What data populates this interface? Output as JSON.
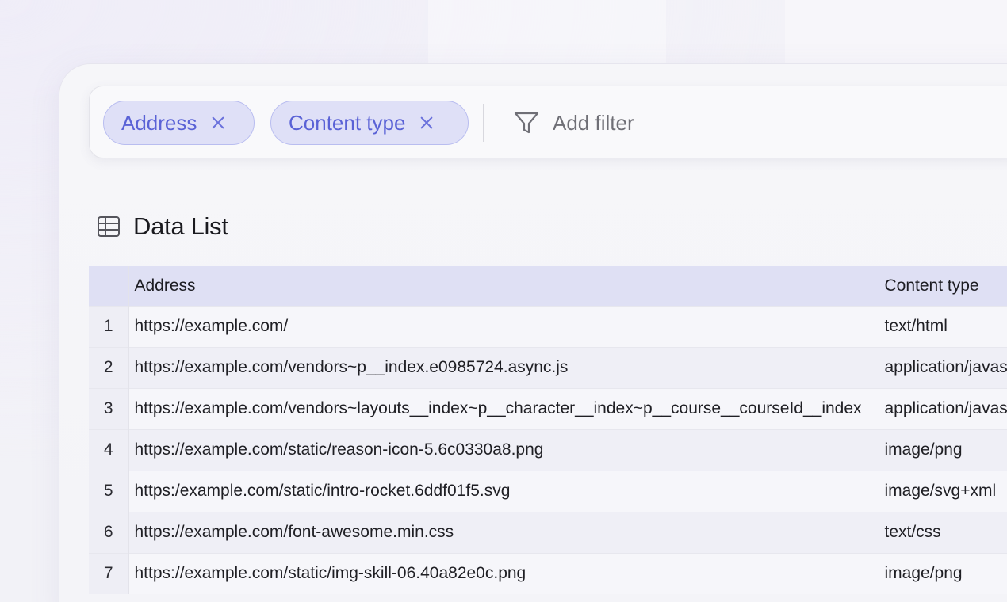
{
  "filters": {
    "chips": [
      {
        "label": "Address"
      },
      {
        "label": "Content type"
      }
    ],
    "add_label": "Add filter"
  },
  "list": {
    "title": "Data List",
    "columns": {
      "index": "",
      "address": "Address",
      "content_type": "Content type"
    },
    "rows": [
      {
        "n": "1",
        "address": "https://example.com/",
        "type": "text/html"
      },
      {
        "n": "2",
        "address": "https://example.com/vendors~p__index.e0985724.async.js",
        "type": "application/javascript"
      },
      {
        "n": "3",
        "address": "https://example.com/vendors~layouts__index~p__character__index~p__course__courseId__index",
        "type": "application/javascript"
      },
      {
        "n": "4",
        "address": "https://example.com/static/reason-icon-5.6c0330a8.png",
        "type": "image/png"
      },
      {
        "n": "5",
        "address": "https:/example.com/static/intro-rocket.6ddf01f5.svg",
        "type": "image/svg+xml"
      },
      {
        "n": "6",
        "address": "https://example.com/font-awesome.min.css",
        "type": "text/css"
      },
      {
        "n": "7",
        "address": "https://example.com/static/img-skill-06.40a82e0c.png",
        "type": "image/png"
      }
    ]
  },
  "icons": {
    "remove": "close-icon",
    "filter": "funnel-icon",
    "table": "table-icon"
  },
  "colors": {
    "chip_bg": "#dfe0f7",
    "chip_text": "#5a62d6",
    "header_bg": "#dfe0f4"
  }
}
